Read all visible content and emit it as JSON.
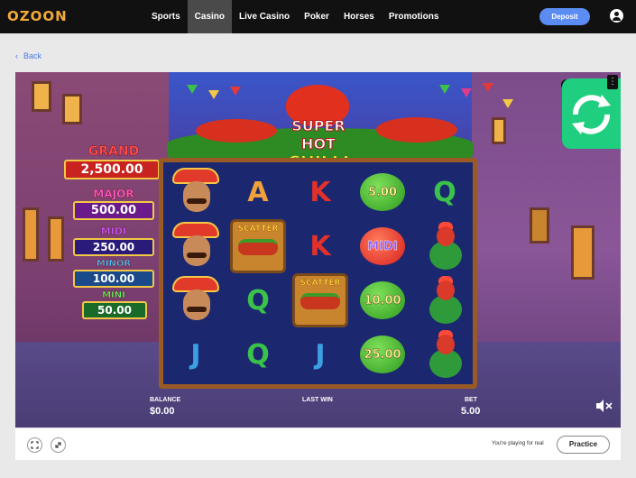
{
  "brand": {
    "logo": "OZOON"
  },
  "nav": {
    "items": [
      {
        "label": "Sports",
        "active": false
      },
      {
        "label": "Casino",
        "active": true
      },
      {
        "label": "Live Casino",
        "active": false
      },
      {
        "label": "Poker",
        "active": false
      },
      {
        "label": "Horses",
        "active": false
      },
      {
        "label": "Promotions",
        "active": false
      }
    ],
    "deposit_label": "Deposit",
    "account_icon": "user-icon"
  },
  "back": {
    "label": "Back",
    "icon": "chevron-left-icon"
  },
  "game": {
    "logo_line1": "SUPER HOT",
    "logo_line2": "CHILLI",
    "jackpots": [
      {
        "name": "GRAND",
        "value": "2,500.00"
      },
      {
        "name": "MAJOR",
        "value": "500.00"
      },
      {
        "name": "MIDI",
        "value": "250.00"
      },
      {
        "name": "MINOR",
        "value": "100.00"
      },
      {
        "name": "MINI",
        "value": "50.00"
      }
    ],
    "reels": [
      [
        {
          "type": "mariachi"
        },
        {
          "type": "mariachi"
        },
        {
          "type": "mariachi"
        },
        {
          "type": "letter",
          "text": "J"
        }
      ],
      [
        {
          "type": "letter",
          "text": "A"
        },
        {
          "type": "scatter",
          "text": "SCATTER"
        },
        {
          "type": "letter",
          "text": "Q"
        },
        {
          "type": "letter",
          "text": "Q"
        }
      ],
      [
        {
          "type": "letter",
          "text": "K"
        },
        {
          "type": "letter",
          "text": "K"
        },
        {
          "type": "scatter",
          "text": "SCATTER"
        },
        {
          "type": "letter",
          "text": "J"
        }
      ],
      [
        {
          "type": "pepper",
          "color": "green",
          "text": "5.00"
        },
        {
          "type": "pepper",
          "color": "red",
          "text": "MIDI"
        },
        {
          "type": "pepper",
          "color": "green",
          "text": "10.00"
        },
        {
          "type": "pepper",
          "color": "green",
          "text": "25.00"
        }
      ],
      [
        {
          "type": "letter",
          "text": "Q"
        },
        {
          "type": "rooster"
        },
        {
          "type": "rooster"
        },
        {
          "type": "rooster"
        }
      ]
    ],
    "hud": {
      "balance_label": "BALANCE",
      "balance_value": "$0.00",
      "last_win_label": "LAST WIN",
      "bet_label": "BET",
      "bet_value": "5.00"
    },
    "mute_icon": "speaker-muted-icon",
    "refresh_icon": "refresh-icon",
    "menu_icon": "kebab-menu-icon"
  },
  "footer": {
    "fullscreen_icon": "fullscreen-icon",
    "expand_icon": "expand-icon",
    "real_text": "You're playing for real",
    "practice_label": "Practice"
  },
  "colors": {
    "topbar": "#111111",
    "accent": "#5b8cf2",
    "link": "#4a7be6",
    "refresh_badge": "#1fcf7f"
  }
}
